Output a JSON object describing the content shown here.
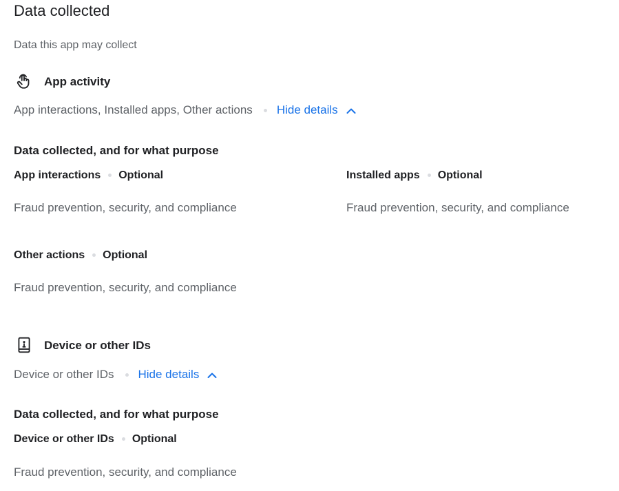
{
  "header": {
    "title": "Data collected",
    "subtitle": "Data this app may collect"
  },
  "categories": [
    {
      "icon": "touch-hand-icon",
      "title": "App activity",
      "summary": "App interactions, Installed apps, Other actions",
      "toggle_label": "Hide details",
      "section_heading": "Data collected, and for what purpose",
      "items": [
        {
          "name": "App interactions",
          "status": "Optional",
          "purpose": "Fraud prevention, security, and compliance"
        },
        {
          "name": "Installed apps",
          "status": "Optional",
          "purpose": "Fraud prevention, security, and compliance"
        },
        {
          "name": "Other actions",
          "status": "Optional",
          "purpose": "Fraud prevention, security, and compliance"
        }
      ]
    },
    {
      "icon": "device-id-icon",
      "title": "Device or other IDs",
      "summary": "Device or other IDs",
      "toggle_label": "Hide details",
      "section_heading": "Data collected, and for what purpose",
      "items": [
        {
          "name": "Device or other IDs",
          "status": "Optional",
          "purpose": "Fraud prevention, security, and compliance"
        }
      ]
    }
  ],
  "colors": {
    "link": "#1a73e8",
    "secondary_text": "#5f6368",
    "primary_text": "#202124"
  }
}
